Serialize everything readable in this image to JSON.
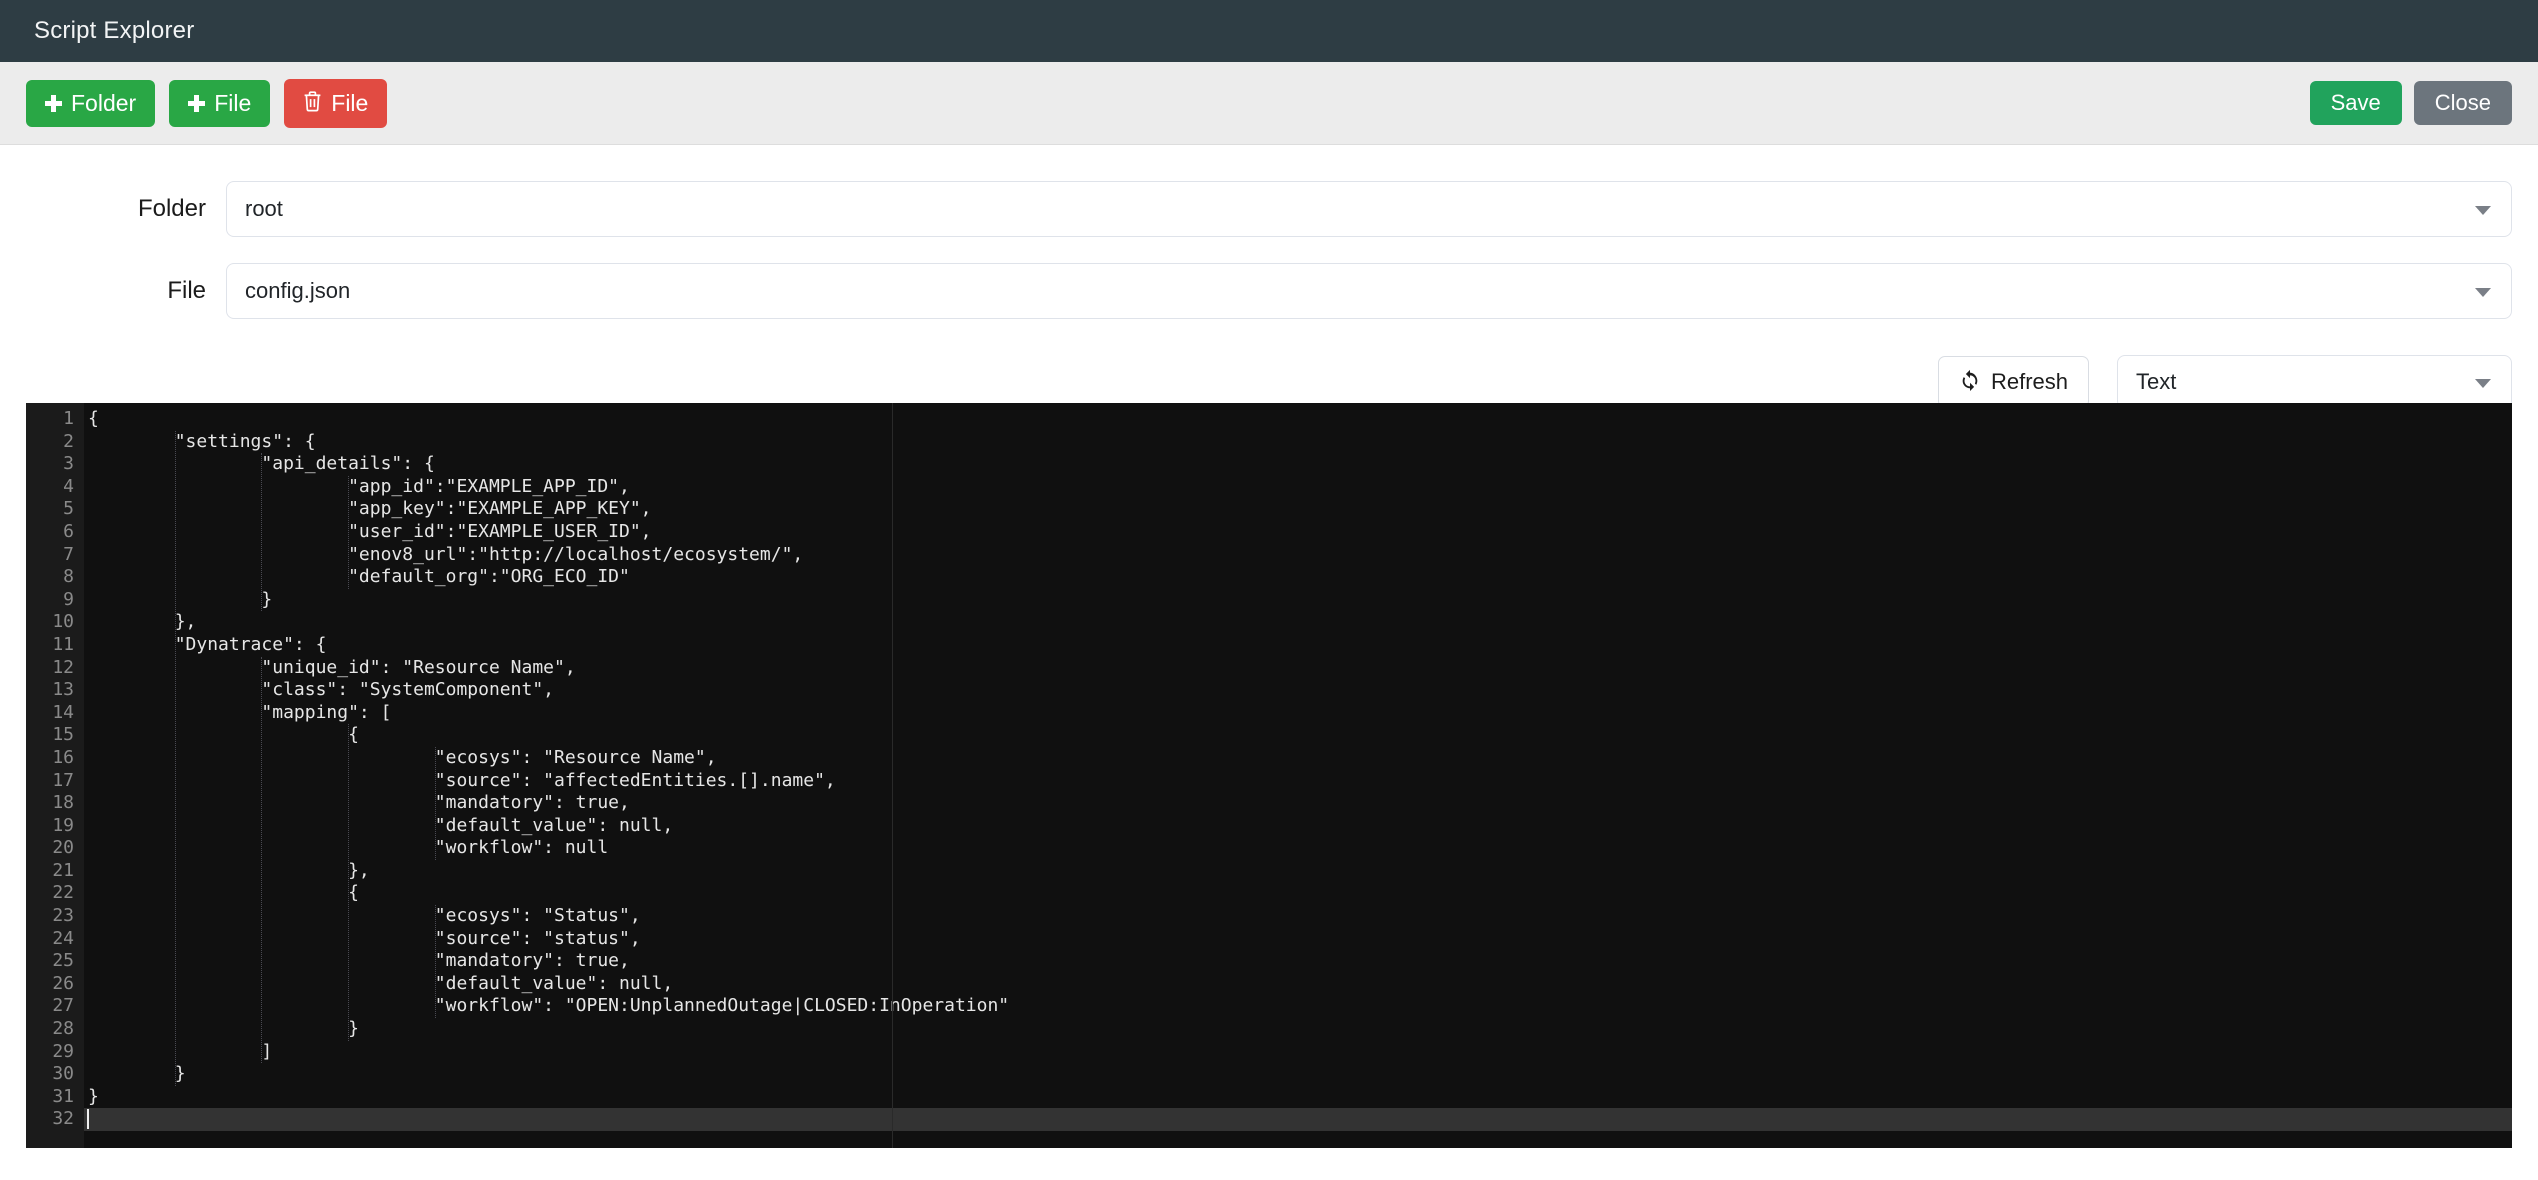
{
  "window": {
    "title": "Script Explorer"
  },
  "toolbar": {
    "add_folder_label": "Folder",
    "add_file_label": "File",
    "delete_file_label": "File",
    "save_label": "Save",
    "close_label": "Close",
    "add_folder_icon": "plus-icon",
    "add_file_icon": "plus-icon",
    "delete_file_icon": "trash-icon"
  },
  "form": {
    "folder_label": "Folder",
    "folder_value": "root",
    "file_label": "File",
    "file_value": "config.json"
  },
  "controls": {
    "refresh_label": "Refresh",
    "refresh_icon": "sync-icon",
    "mode_value": "Text"
  },
  "colors": {
    "titlebar": "#2e3d44",
    "toolbar_bg": "#ececec",
    "green": "#29a745",
    "red": "#e14b42",
    "grey": "#6c757d",
    "save_green": "#21a35c",
    "editor_bg": "#101010",
    "gutter_bg": "#1b1b1b",
    "active_line": "#333333"
  },
  "editor": {
    "total_lines": 32,
    "active_line": 32,
    "lines": [
      "{",
      "        \"settings\": {",
      "                \"api_details\": {",
      "                        \"app_id\":\"EXAMPLE_APP_ID\",",
      "                        \"app_key\":\"EXAMPLE_APP_KEY\",",
      "                        \"user_id\":\"EXAMPLE_USER_ID\",",
      "                        \"enov8_url\":\"http://localhost/ecosystem/\",",
      "                        \"default_org\":\"ORG_ECO_ID\"",
      "                }",
      "        },",
      "        \"Dynatrace\": {",
      "                \"unique_id\": \"Resource Name\",",
      "                \"class\": \"SystemComponent\",",
      "                \"mapping\": [",
      "                        {",
      "                                \"ecosys\": \"Resource Name\",",
      "                                \"source\": \"affectedEntities.[].name\",",
      "                                \"mandatory\": true,",
      "                                \"default_value\": null,",
      "                                \"workflow\": null",
      "                        },",
      "                        {",
      "                                \"ecosys\": \"Status\",",
      "                                \"source\": \"status\",",
      "                                \"mandatory\": true,",
      "                                \"default_value\": null,",
      "                                \"workflow\": \"OPEN:UnplannedOutage|CLOSED:InOperation\"",
      "                        }",
      "                ]",
      "        }",
      "}",
      ""
    ]
  }
}
